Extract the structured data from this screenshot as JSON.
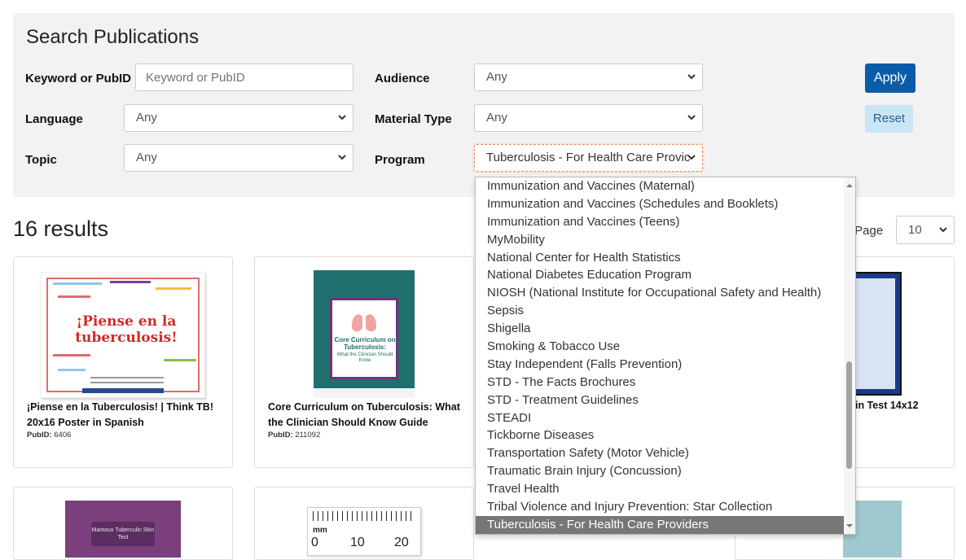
{
  "search": {
    "title": "Search Publications",
    "keyword_label": "Keyword or PubID",
    "keyword_placeholder": "Keyword or PubID",
    "language_label": "Language",
    "language_value": "Any",
    "topic_label": "Topic",
    "topic_value": "Any",
    "audience_label": "Audience",
    "audience_value": "Any",
    "material_type_label": "Material Type",
    "material_type_value": "Any",
    "program_label": "Program",
    "program_value": "Tuberculosis - For Health Care Provic",
    "apply_label": "Apply",
    "reset_label": "Reset"
  },
  "results": {
    "count_text": "16 results",
    "per_page_label": "r Page",
    "per_page_value": "10"
  },
  "cards": [
    {
      "title": "¡Piense en la Tuberculosis! | Think TB! 20x16 Poster in Spanish",
      "pubid_label": "PubID:",
      "pubid_value": "6406",
      "poster_title": "¡Piense en la tuberculosis!"
    },
    {
      "title": "Core Curriculum on Tuberculosis: What the Clinician Should Know Guide",
      "pubid_label": "PubID:",
      "pubid_value": "211092",
      "cover_title": "Core Curriculum on Tuberculosis:",
      "cover_subtitle": "What the Clinician Should Know"
    },
    {
      "title_fragment": "in Test 14x12"
    }
  ],
  "bottom_cards": {
    "dvd_label": "Mantoux Tuberculin Skin Test",
    "ruler_unit": "mm",
    "ruler_ticks": [
      "0",
      "10",
      "20"
    ]
  },
  "program_dropdown": {
    "items": [
      "Immunization and Vaccines (Maternal)",
      "Immunization and Vaccines (Schedules and Booklets)",
      "Immunization and Vaccines (Teens)",
      "MyMobility",
      "National Center for Health Statistics",
      "National Diabetes Education Program",
      "NIOSH (National Institute for Occupational Safety and Health)",
      "Sepsis",
      "Shigella",
      "Smoking & Tobacco Use",
      "Stay Independent (Falls Prevention)",
      "STD - The Facts Brochures",
      "STD - Treatment Guidelines",
      "STEADI",
      "Tickborne Diseases",
      "Transportation Safety (Motor Vehicle)",
      "Traumatic Brain Injury (Concussion)",
      "Travel Health",
      "Tribal Violence and Injury Prevention: Star Collection",
      "Tuberculosis - For Health Care Providers"
    ],
    "selected_index": 19
  },
  "colors": {
    "panel_bg": "#f2f2f2",
    "apply_bg": "#0b5ca8",
    "reset_bg": "#c9e6f7",
    "selected_item_bg": "#777777",
    "cover_teal": "#1f6f6f",
    "dvd_purple": "#7a3f7c"
  }
}
